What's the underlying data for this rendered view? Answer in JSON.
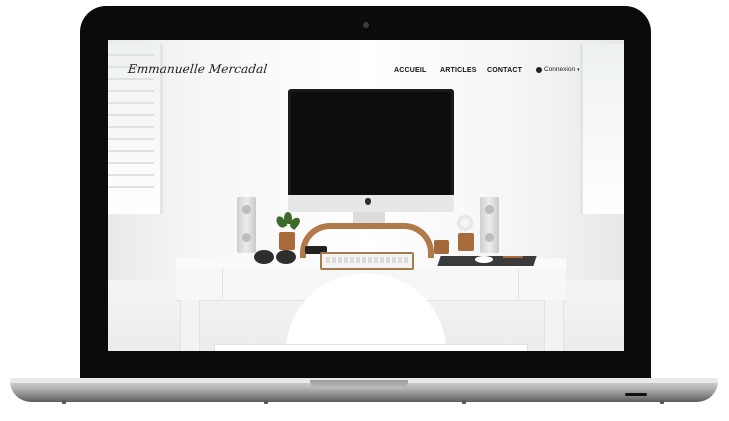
{
  "site": {
    "brand": "Emmanuelle Mercadal"
  },
  "nav": {
    "items": [
      {
        "label": "ACCUEIL"
      },
      {
        "label": "ARTICLES"
      },
      {
        "label": "CONTACT"
      }
    ],
    "account": {
      "icon": "user-icon",
      "label": "Connexion",
      "caret": "▾"
    }
  },
  "colors": {
    "bezel": "#0b0b0b",
    "wood": "#b07b49",
    "text": "#111111"
  }
}
